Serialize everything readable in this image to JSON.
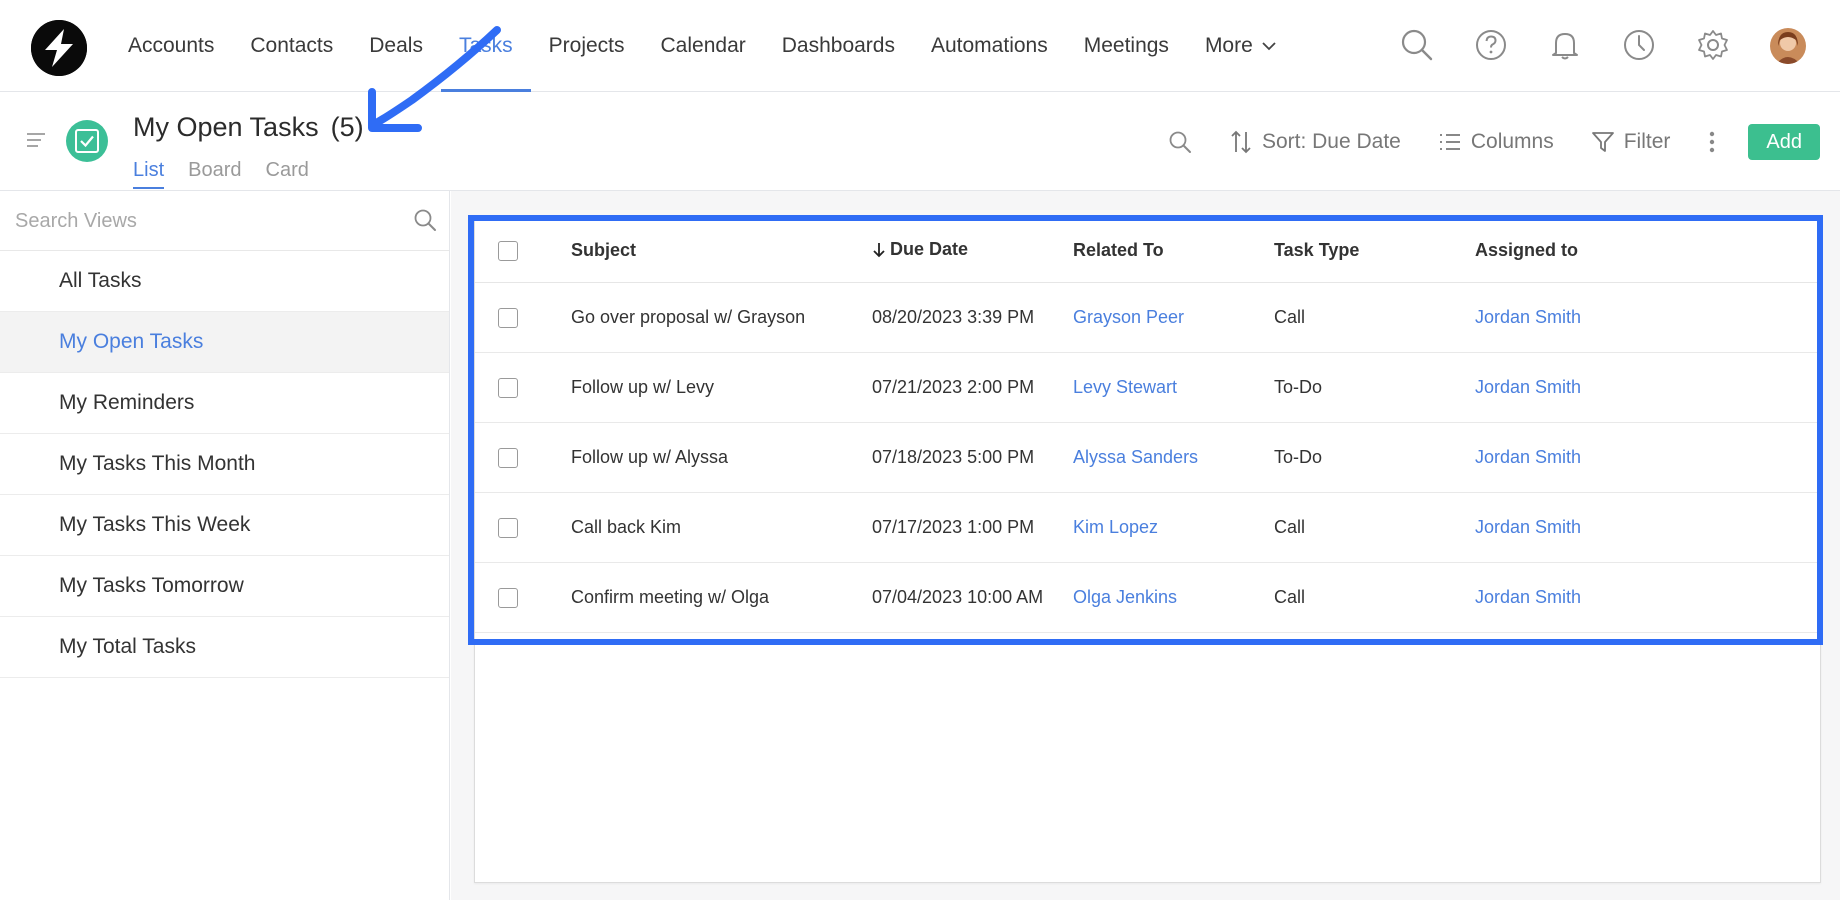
{
  "app": {
    "accent_color": "#4a7fde",
    "brand_green": "#3cbf8f",
    "highlight_color": "#2f6cf5"
  },
  "nav": {
    "items": [
      {
        "label": "Accounts"
      },
      {
        "label": "Contacts"
      },
      {
        "label": "Deals"
      },
      {
        "label": "Tasks",
        "active": true
      },
      {
        "label": "Projects"
      },
      {
        "label": "Calendar"
      },
      {
        "label": "Dashboards"
      },
      {
        "label": "Automations"
      },
      {
        "label": "Meetings"
      }
    ],
    "more_label": "More",
    "icons": [
      "search-icon",
      "help-icon",
      "bell-icon",
      "clock-icon",
      "gear-icon",
      "avatar"
    ]
  },
  "header": {
    "title": "My Open Tasks",
    "count": "(5)",
    "tabs": [
      {
        "label": "List",
        "active": true
      },
      {
        "label": "Board"
      },
      {
        "label": "Card"
      }
    ],
    "sort_label": "Sort: Due Date",
    "columns_label": "Columns",
    "filter_label": "Filter",
    "add_label": "Add"
  },
  "sidebar": {
    "search_placeholder": "Search Views",
    "items": [
      {
        "label": "All Tasks"
      },
      {
        "label": "My Open Tasks",
        "active": true
      },
      {
        "label": "My Reminders"
      },
      {
        "label": "My Tasks This Month"
      },
      {
        "label": "My Tasks This Week"
      },
      {
        "label": "My Tasks Tomorrow"
      },
      {
        "label": "My Total Tasks"
      }
    ]
  },
  "table": {
    "columns": {
      "subject": "Subject",
      "due_date": "Due Date",
      "related_to": "Related To",
      "task_type": "Task Type",
      "assigned_to": "Assigned to"
    },
    "rows": [
      {
        "subject": "Go over proposal w/ Grayson",
        "due": "08/20/2023 3:39 PM",
        "related": "Grayson Peer",
        "type": "Call",
        "assigned": "Jordan Smith"
      },
      {
        "subject": "Follow up w/ Levy",
        "due": "07/21/2023 2:00 PM",
        "related": "Levy Stewart",
        "type": "To-Do",
        "assigned": "Jordan Smith"
      },
      {
        "subject": "Follow up w/ Alyssa",
        "due": "07/18/2023 5:00 PM",
        "related": "Alyssa Sanders",
        "type": "To-Do",
        "assigned": "Jordan Smith"
      },
      {
        "subject": "Call back Kim",
        "due": "07/17/2023 1:00 PM",
        "related": "Kim Lopez",
        "type": "Call",
        "assigned": "Jordan Smith"
      },
      {
        "subject": "Confirm meeting w/ Olga",
        "due": "07/04/2023 10:00 AM",
        "related": "Olga Jenkins",
        "type": "Call",
        "assigned": "Jordan Smith"
      }
    ]
  }
}
